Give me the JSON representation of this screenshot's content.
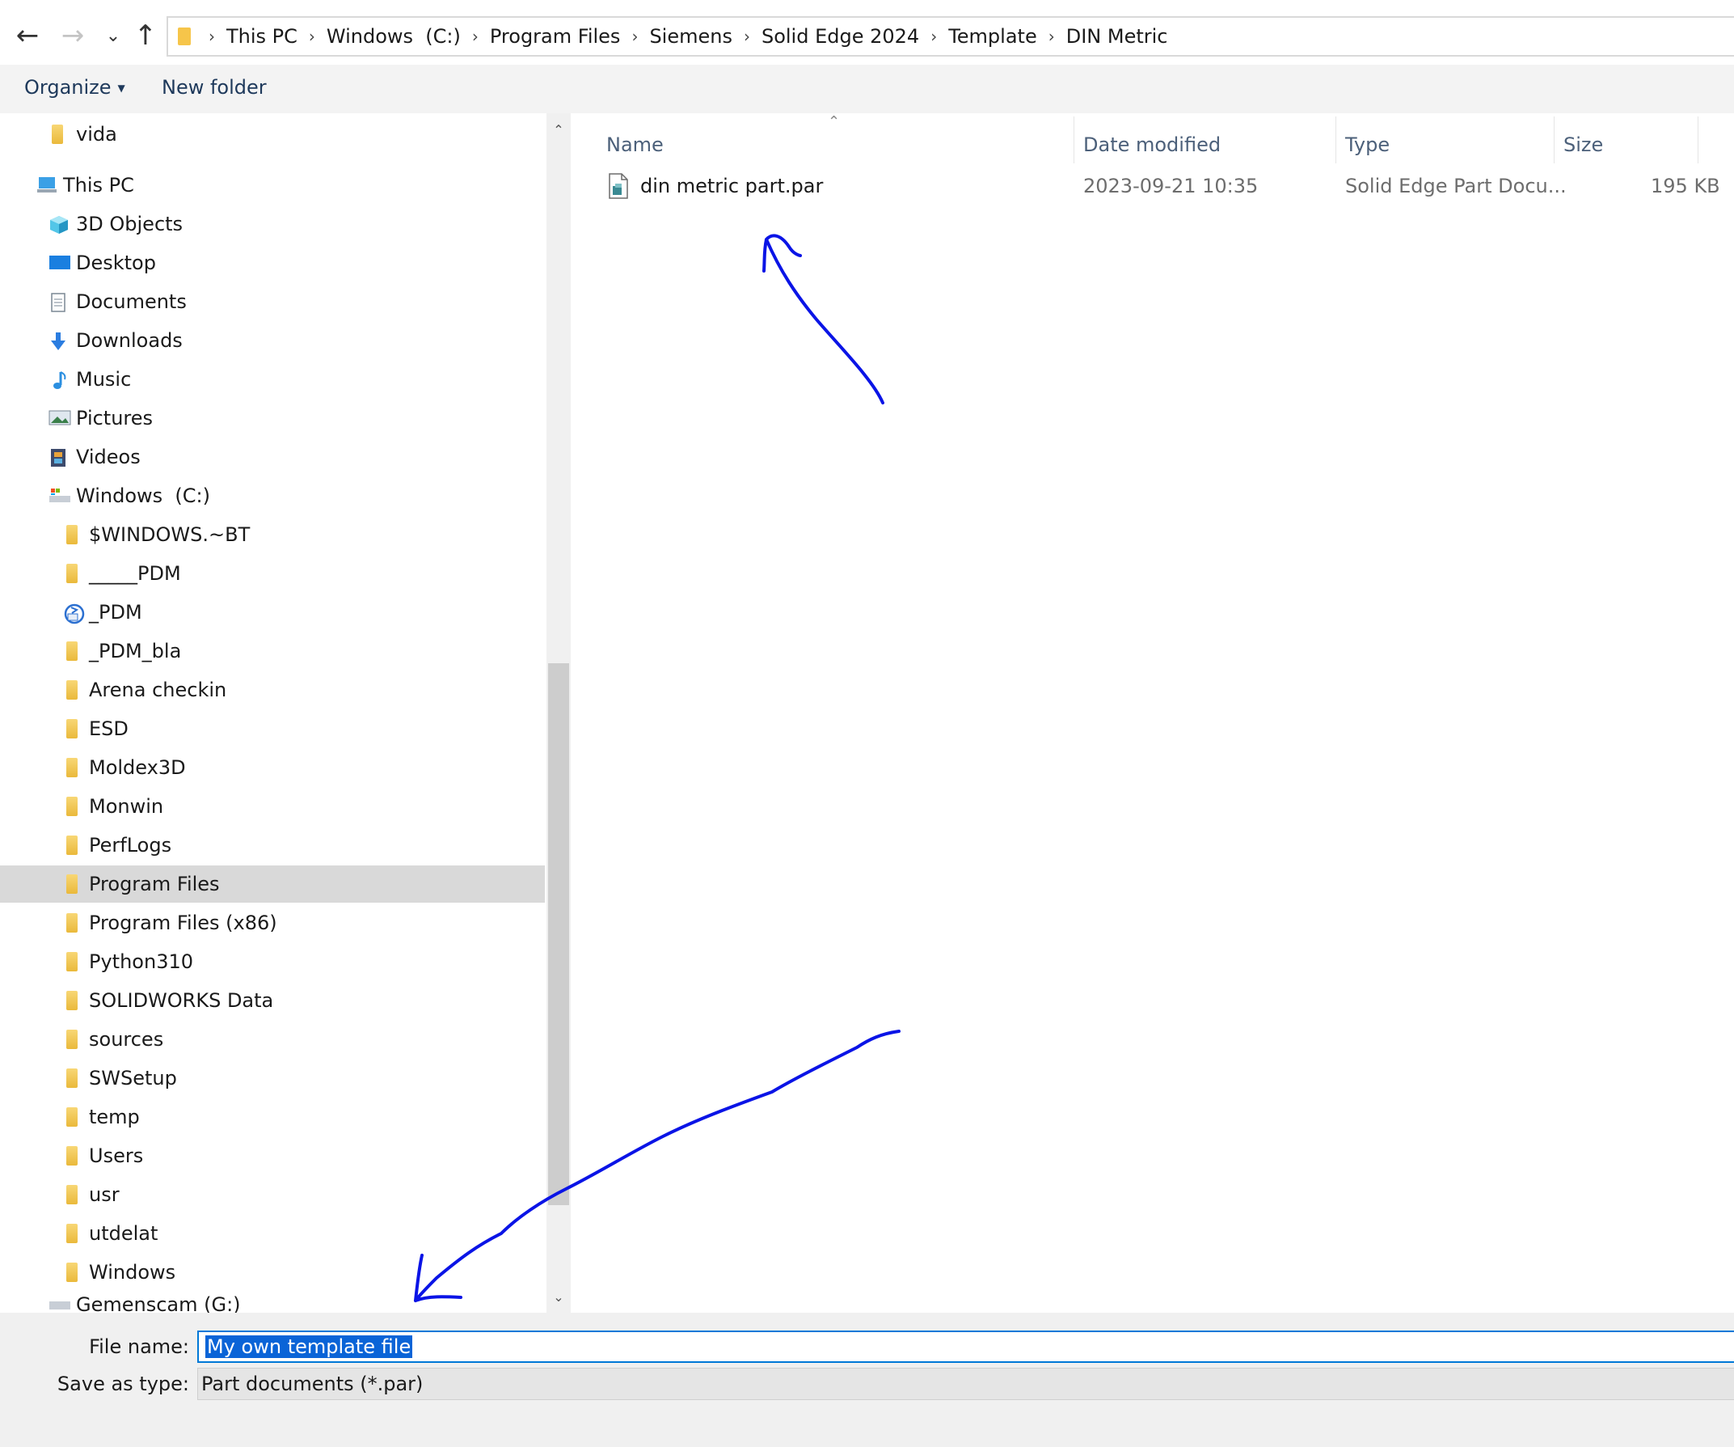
{
  "address": {
    "crumbs": [
      "This PC",
      "Windows  (C:)",
      "Program Files",
      "Siemens",
      "Solid Edge 2024",
      "Template",
      "DIN Metric"
    ]
  },
  "toolbar": {
    "organize_label": "Organize",
    "new_folder_label": "New folder"
  },
  "nav": {
    "items": [
      {
        "label": "vida",
        "icon": "folder-icon"
      },
      {
        "label": "This PC",
        "icon": "computer-icon"
      },
      {
        "label": "3D Objects",
        "icon": "cube-icon"
      },
      {
        "label": "Desktop",
        "icon": "desktop-icon"
      },
      {
        "label": "Documents",
        "icon": "documents-icon"
      },
      {
        "label": "Downloads",
        "icon": "download-arrow-icon"
      },
      {
        "label": "Music",
        "icon": "music-note-icon"
      },
      {
        "label": "Pictures",
        "icon": "pictures-icon"
      },
      {
        "label": "Videos",
        "icon": "film-icon"
      },
      {
        "label": "Windows  (C:)",
        "icon": "drive-icon"
      },
      {
        "label": "$WINDOWS.~BT",
        "icon": "folder-icon"
      },
      {
        "label": "_____PDM",
        "icon": "folder-icon"
      },
      {
        "label": "_PDM",
        "icon": "sync-folder-icon"
      },
      {
        "label": "_PDM_bla",
        "icon": "folder-icon"
      },
      {
        "label": "Arena checkin",
        "icon": "folder-icon"
      },
      {
        "label": "ESD",
        "icon": "folder-icon"
      },
      {
        "label": "Moldex3D",
        "icon": "folder-icon"
      },
      {
        "label": "Monwin",
        "icon": "folder-icon"
      },
      {
        "label": "PerfLogs",
        "icon": "folder-icon"
      },
      {
        "label": "Program Files",
        "icon": "folder-icon"
      },
      {
        "label": "Program Files (x86)",
        "icon": "folder-icon"
      },
      {
        "label": "Python310",
        "icon": "folder-icon"
      },
      {
        "label": "SOLIDWORKS Data",
        "icon": "folder-icon"
      },
      {
        "label": "sources",
        "icon": "folder-icon"
      },
      {
        "label": "SWSetup",
        "icon": "folder-icon"
      },
      {
        "label": "temp",
        "icon": "folder-icon"
      },
      {
        "label": "Users",
        "icon": "folder-icon"
      },
      {
        "label": "usr",
        "icon": "folder-icon"
      },
      {
        "label": "utdelat",
        "icon": "folder-icon"
      },
      {
        "label": "Windows",
        "icon": "folder-icon"
      },
      {
        "label": "Gemenscam (G:)",
        "icon": "network-drive-icon"
      }
    ],
    "selected": "Program Files"
  },
  "list": {
    "columns": [
      "Name",
      "Date modified",
      "Type",
      "Size"
    ],
    "files": [
      {
        "name": "din metric part.par",
        "date": "2023-09-21 10:35",
        "type": "Solid Edge Part Docu...",
        "size": "195 KB"
      }
    ]
  },
  "save": {
    "filename_label": "File name:",
    "filename_value": "My own template file",
    "type_label": "Save as type:",
    "type_value": "Part documents (*.par)"
  },
  "colors": {
    "annotation": "#0a14e6",
    "selection": "#0a64d7",
    "folder": "#f6c54a"
  }
}
